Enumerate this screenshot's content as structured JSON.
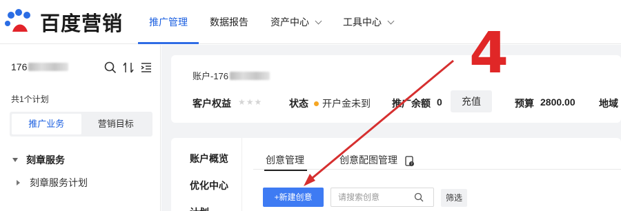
{
  "brand": {
    "logo_text": "百度营销",
    "accent": "#2f6ce5"
  },
  "nav": {
    "items": [
      {
        "label": "推广管理",
        "active": true,
        "dropdown": false
      },
      {
        "label": "数据报告",
        "active": false,
        "dropdown": false
      },
      {
        "label": "资产中心",
        "active": false,
        "dropdown": true
      },
      {
        "label": "工具中心",
        "active": false,
        "dropdown": true
      }
    ]
  },
  "sidebar": {
    "account_prefix": "176",
    "icons": [
      "search-icon",
      "sort-icon",
      "list-icon"
    ],
    "plan_count": "共1个计划",
    "segments": [
      {
        "label": "推广业务",
        "active": true
      },
      {
        "label": "营销目标",
        "active": false
      }
    ],
    "tree": {
      "business": "刻章服务",
      "plan": "刻章服务计划"
    }
  },
  "account_card": {
    "title_prefix": "账户-176",
    "rights_label": "客户权益",
    "stars": "★★★",
    "status_label": "状态",
    "status_value": "开户金未到",
    "status_color": "#f5a623",
    "balance_label": "推广余额",
    "balance_value": "0",
    "recharge_label": "充值",
    "budget_label": "预算",
    "budget_value": "2800.00",
    "region_label": "地域"
  },
  "detail": {
    "vnav": [
      "账户概览",
      "优化中心",
      "计划"
    ],
    "tabs": [
      {
        "label": "创意管理",
        "active": true
      },
      {
        "label": "创意配图管理",
        "active": false
      }
    ],
    "new_button": "+新建创意",
    "search_placeholder": "请搜索创意",
    "filter_label": "筛选"
  },
  "annotation": {
    "number": "4",
    "color": "#e02727"
  }
}
